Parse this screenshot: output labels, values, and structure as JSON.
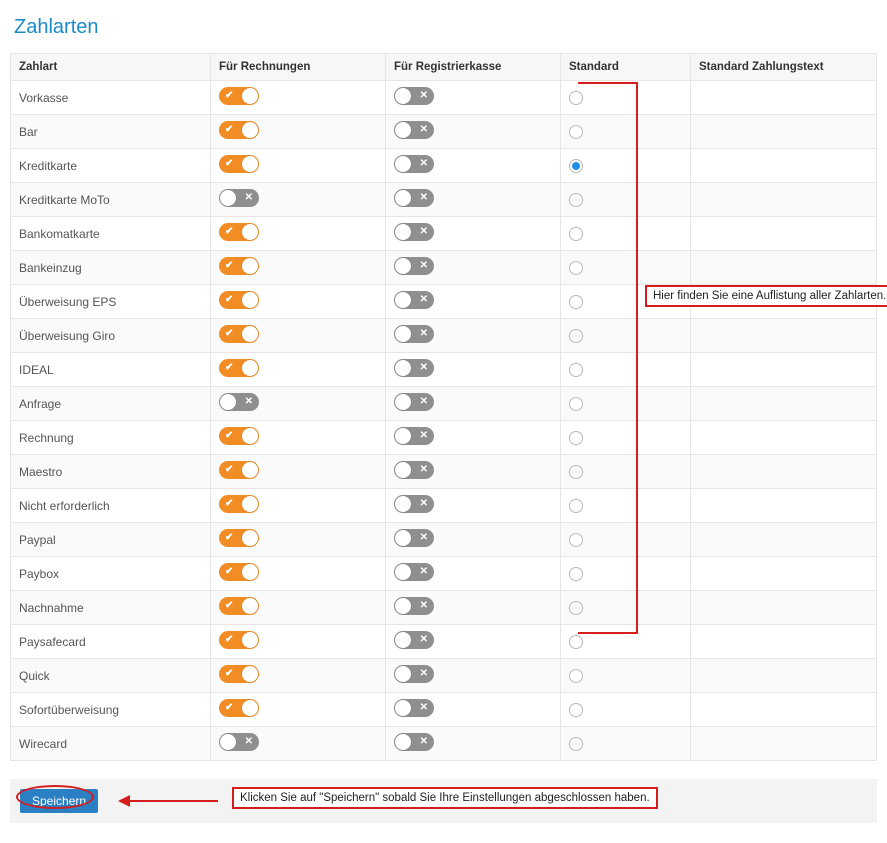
{
  "title": "Zahlarten",
  "columns": {
    "zahlart": "Zahlart",
    "rechnungen": "Für Rechnungen",
    "registrierkasse": "Für Registrierkasse",
    "standard": "Standard",
    "zahlungstext": "Standard Zahlungstext"
  },
  "rows": [
    {
      "name": "Vorkasse",
      "invoices": true,
      "register": false,
      "standard": false,
      "text": ""
    },
    {
      "name": "Bar",
      "invoices": true,
      "register": false,
      "standard": false,
      "text": ""
    },
    {
      "name": "Kreditkarte",
      "invoices": true,
      "register": false,
      "standard": true,
      "text": ""
    },
    {
      "name": "Kreditkarte MoTo",
      "invoices": false,
      "register": false,
      "standard": false,
      "text": ""
    },
    {
      "name": "Bankomatkarte",
      "invoices": true,
      "register": false,
      "standard": false,
      "text": ""
    },
    {
      "name": "Bankeinzug",
      "invoices": true,
      "register": false,
      "standard": false,
      "text": ""
    },
    {
      "name": "Überweisung EPS",
      "invoices": true,
      "register": false,
      "standard": false,
      "text": ""
    },
    {
      "name": "Überweisung Giro",
      "invoices": true,
      "register": false,
      "standard": false,
      "text": ""
    },
    {
      "name": "IDEAL",
      "invoices": true,
      "register": false,
      "standard": false,
      "text": ""
    },
    {
      "name": "Anfrage",
      "invoices": false,
      "register": false,
      "standard": false,
      "text": ""
    },
    {
      "name": "Rechnung",
      "invoices": true,
      "register": false,
      "standard": false,
      "text": ""
    },
    {
      "name": "Maestro",
      "invoices": true,
      "register": false,
      "standard": false,
      "text": ""
    },
    {
      "name": "Nicht erforderlich",
      "invoices": true,
      "register": false,
      "standard": false,
      "text": ""
    },
    {
      "name": "Paypal",
      "invoices": true,
      "register": false,
      "standard": false,
      "text": ""
    },
    {
      "name": "Paybox",
      "invoices": true,
      "register": false,
      "standard": false,
      "text": ""
    },
    {
      "name": "Nachnahme",
      "invoices": true,
      "register": false,
      "standard": false,
      "text": ""
    },
    {
      "name": "Paysafecard",
      "invoices": true,
      "register": false,
      "standard": false,
      "text": ""
    },
    {
      "name": "Quick",
      "invoices": true,
      "register": false,
      "standard": false,
      "text": ""
    },
    {
      "name": "Sofortüberweisung",
      "invoices": true,
      "register": false,
      "standard": false,
      "text": ""
    },
    {
      "name": "Wirecard",
      "invoices": false,
      "register": false,
      "standard": false,
      "text": ""
    }
  ],
  "buttons": {
    "save": "Speichern"
  },
  "hints": {
    "list": "Hier finden Sie eine Auflistung aller Zahlarten.",
    "save": "Klicken Sie auf \"Speichern\" sobald Sie Ihre Einstellungen abgeschlossen haben."
  },
  "icons": {
    "check": "✔",
    "cross": "✕"
  },
  "colors": {
    "accent": "#1a8bc6",
    "toggleOn": "#f28c24",
    "toggleOff": "#8f8f8f",
    "highlight": "#d61d1d",
    "saveBtn": "#2b7fc3"
  }
}
